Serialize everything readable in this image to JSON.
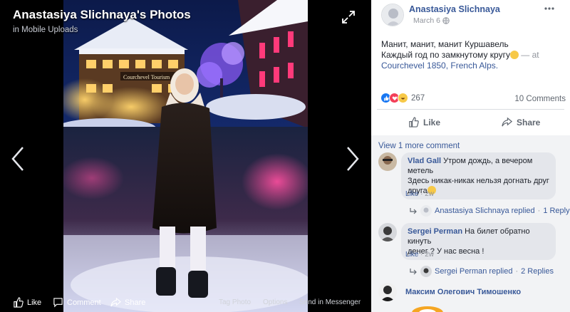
{
  "viewer": {
    "album_title": "Anastasiya Slichnaya's Photos",
    "album_subtitle": "in Mobile Uploads",
    "bottom_bar": {
      "like": "Like",
      "comment": "Comment",
      "share": "Share",
      "tag_photo": "Tag Photo",
      "options": "Options",
      "send": "Send in Messenger"
    },
    "sign_text": "Courchevel Tourism"
  },
  "post": {
    "author": "Anastasiya Slichnaya",
    "date": "March 6 ·",
    "text_line1": "Манит, манит, манит Куршавель",
    "text_line2": "Каждый год по замкнутому кругу",
    "at": " — at",
    "location": "Courchevel 1850, French Alps.",
    "reaction_count": "267",
    "comment_count": "10 Comments",
    "actions": {
      "like": "Like",
      "share": "Share"
    }
  },
  "comments": {
    "view_more": "View 1 more comment",
    "items": [
      {
        "name": "Vlad Gall",
        "text_line1": " Утром дождь, а вечером метель",
        "text_line2": "Здесь никак-никак нельзя догнать друг",
        "text_line3": "друга",
        "like": "Like",
        "time": "2w",
        "reply_author": "Anastasiya Slichnaya replied",
        "reply_count": "1 Reply"
      },
      {
        "name": "Sergei Perman",
        "text_line1": " На билет обратно кинуть",
        "text_line2": "денег ? У нас весна !",
        "like": "Like",
        "time": "2w",
        "reply_author": "Sergei Perman replied",
        "reply_count": "2 Replies"
      },
      {
        "name": "Максим Олегович Тимошенко"
      }
    ]
  },
  "colors": {
    "link": "#385898",
    "meta": "#90949c",
    "like_blue": "#1877f2",
    "love_red": "#f33e58",
    "haha_yellow": "#f7c948"
  }
}
